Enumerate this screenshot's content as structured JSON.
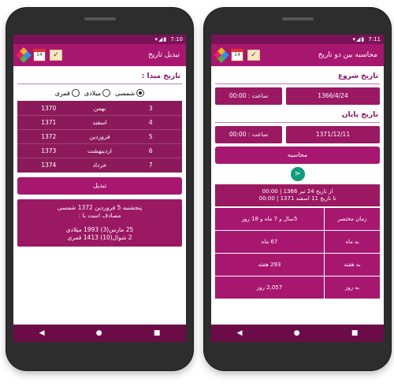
{
  "status": {
    "time_left": "7:10",
    "time_right": "7:11",
    "icons": "▾◢▮"
  },
  "left_screen": {
    "appbar": {
      "title": "تبدیل تاریخ",
      "cal_num": "14"
    },
    "section_title": "تاریخ مبدا :",
    "radios": [
      {
        "label": "شمسی",
        "checked": true
      },
      {
        "label": "میلادی",
        "checked": false
      },
      {
        "label": "قمری",
        "checked": false
      }
    ],
    "rows": [
      {
        "num": "3",
        "month": "بهمن",
        "year": "1370"
      },
      {
        "num": "4",
        "month": "اسفند",
        "year": "1371"
      },
      {
        "num": "5",
        "month": "فروردین",
        "year": "1372"
      },
      {
        "num": "6",
        "month": "اردیبهشت",
        "year": "1373"
      },
      {
        "num": "7",
        "month": "خرداد",
        "year": "1374"
      }
    ],
    "convert_button": "تبدیل",
    "result": {
      "line1": "پنجشنبه 5 فروردین 1372 شمسی",
      "line2": "مصادف است با :",
      "line3": "25 مارس(3) 1993 میلادی",
      "line4": "2 شوال(10) 1413 قمری"
    }
  },
  "right_screen": {
    "appbar": {
      "title": "محاسبه بین دو تاریخ",
      "cal_num": "14"
    },
    "start_title": "تاریخ شروع",
    "start_time": "ساعت :  00:00",
    "start_date": "1366/4/24",
    "end_title": "تاریخ پایان",
    "end_time": "ساعت :  00:00",
    "end_date": "1371/12/11",
    "calc_button": "محاسبه",
    "fromto_line1": "از تاریخ 24 تیر 1366 | 00:00",
    "fromto_line2": "تا تاریخ 11 اسفند 1371 | 00:00",
    "results": [
      {
        "label": "زمان مختصر",
        "value": "5سال و 7 ماه و 18 روز"
      },
      {
        "label": "به ماه",
        "value": "67 ماه"
      },
      {
        "label": "به هفته",
        "value": "293 هفته"
      },
      {
        "label": "به روز",
        "value": "2,057 روز"
      }
    ]
  },
  "nav": {
    "back": "◀",
    "home": "●",
    "recent": "■"
  },
  "colors": {
    "primary": "#a8176f",
    "dark": "#7a1258",
    "accent": "#0f9c7a"
  }
}
